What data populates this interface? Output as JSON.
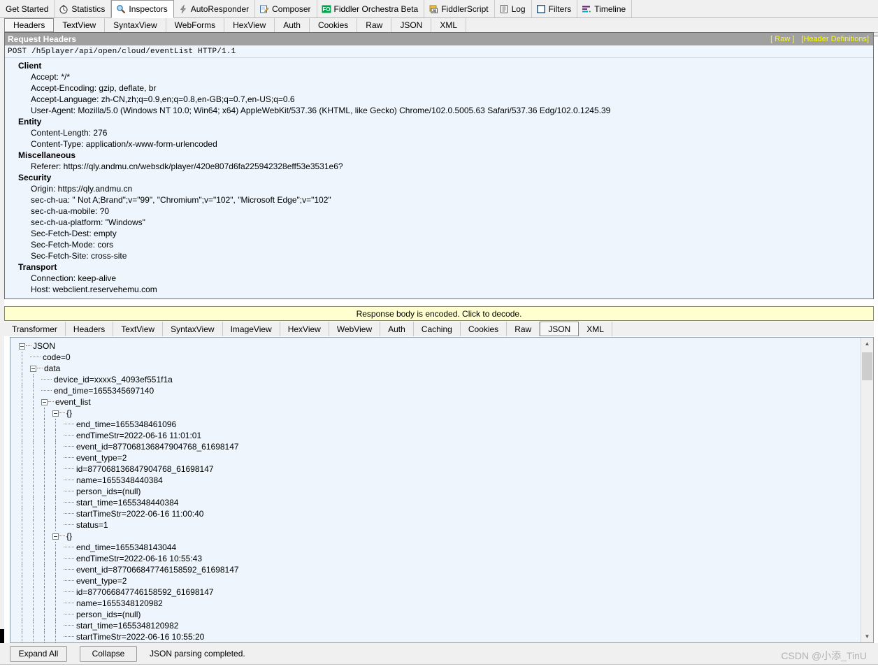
{
  "main_tabs": [
    {
      "label": "Get Started",
      "icon": "none",
      "selected": false
    },
    {
      "label": "Statistics",
      "icon": "stopwatch-icon",
      "selected": false
    },
    {
      "label": "Inspectors",
      "icon": "magnifier-icon",
      "selected": true
    },
    {
      "label": "AutoResponder",
      "icon": "lightning-icon",
      "selected": false
    },
    {
      "label": "Composer",
      "icon": "pencil-note-icon",
      "selected": false
    },
    {
      "label": "Fiddler Orchestra Beta",
      "icon": "fo-badge-icon",
      "selected": false
    },
    {
      "label": "FiddlerScript",
      "icon": "js-scroll-icon",
      "selected": false
    },
    {
      "label": "Log",
      "icon": "log-icon",
      "selected": false
    },
    {
      "label": "Filters",
      "icon": "filters-icon",
      "selected": false
    },
    {
      "label": "Timeline",
      "icon": "timeline-icon",
      "selected": false
    }
  ],
  "request_tabs": [
    {
      "label": "Headers",
      "selected": true
    },
    {
      "label": "TextView",
      "selected": false
    },
    {
      "label": "SyntaxView",
      "selected": false
    },
    {
      "label": "WebForms",
      "selected": false
    },
    {
      "label": "HexView",
      "selected": false
    },
    {
      "label": "Auth",
      "selected": false
    },
    {
      "label": "Cookies",
      "selected": false
    },
    {
      "label": "Raw",
      "selected": false
    },
    {
      "label": "JSON",
      "selected": false
    },
    {
      "label": "XML",
      "selected": false
    }
  ],
  "request_headers": {
    "title": "Request Headers",
    "raw_link": "[ Raw ]",
    "definitions_link": "[Header Definitions]",
    "request_line": "POST /h5player/api/open/cloud/eventList HTTP/1.1",
    "groups": [
      {
        "name": "Client",
        "items": [
          "Accept: */*",
          "Accept-Encoding: gzip, deflate, br",
          "Accept-Language: zh-CN,zh;q=0.9,en;q=0.8,en-GB;q=0.7,en-US;q=0.6",
          "User-Agent: Mozilla/5.0 (Windows NT 10.0; Win64; x64) AppleWebKit/537.36 (KHTML, like Gecko) Chrome/102.0.5005.63 Safari/537.36 Edg/102.0.1245.39"
        ]
      },
      {
        "name": "Entity",
        "items": [
          "Content-Length: 276",
          "Content-Type: application/x-www-form-urlencoded"
        ]
      },
      {
        "name": "Miscellaneous",
        "items": [
          "Referer: https://qly.andmu.cn/websdk/player/420e807d6fa225942328eff53e3531e6?"
        ]
      },
      {
        "name": "Security",
        "items": [
          "Origin: https://qly.andmu.cn",
          "sec-ch-ua: \" Not A;Brand\";v=\"99\", \"Chromium\";v=\"102\", \"Microsoft Edge\";v=\"102\"",
          "sec-ch-ua-mobile: ?0",
          "sec-ch-ua-platform: \"Windows\"",
          "Sec-Fetch-Dest: empty",
          "Sec-Fetch-Mode: cors",
          "Sec-Fetch-Site: cross-site"
        ]
      },
      {
        "name": "Transport",
        "items": [
          "Connection: keep-alive",
          "Host: webclient.reservehemu.com"
        ]
      }
    ]
  },
  "decode_notice": "Response body is encoded. Click to decode.",
  "response_tabs": [
    {
      "label": "Transformer",
      "selected": false
    },
    {
      "label": "Headers",
      "selected": false
    },
    {
      "label": "TextView",
      "selected": false
    },
    {
      "label": "SyntaxView",
      "selected": false
    },
    {
      "label": "ImageView",
      "selected": false
    },
    {
      "label": "HexView",
      "selected": false
    },
    {
      "label": "WebView",
      "selected": false
    },
    {
      "label": "Auth",
      "selected": false
    },
    {
      "label": "Caching",
      "selected": false
    },
    {
      "label": "Cookies",
      "selected": false
    },
    {
      "label": "Raw",
      "selected": false
    },
    {
      "label": "JSON",
      "selected": true
    },
    {
      "label": "XML",
      "selected": false
    }
  ],
  "json_tree": [
    {
      "depth": 0,
      "label": "JSON",
      "type": "branch"
    },
    {
      "depth": 1,
      "label": "code=0",
      "type": "leaf"
    },
    {
      "depth": 1,
      "label": "data",
      "type": "branch"
    },
    {
      "depth": 2,
      "label": "device_id=xxxxS_4093ef551f1a",
      "type": "leaf"
    },
    {
      "depth": 2,
      "label": "end_time=1655345697140",
      "type": "leaf"
    },
    {
      "depth": 2,
      "label": "event_list",
      "type": "branch"
    },
    {
      "depth": 3,
      "label": "{}",
      "type": "branch"
    },
    {
      "depth": 4,
      "label": "end_time=1655348461096",
      "type": "leaf"
    },
    {
      "depth": 4,
      "label": "endTimeStr=2022-06-16 11:01:01",
      "type": "leaf"
    },
    {
      "depth": 4,
      "label": "event_id=877068136847904768_61698147",
      "type": "leaf"
    },
    {
      "depth": 4,
      "label": "event_type=2",
      "type": "leaf"
    },
    {
      "depth": 4,
      "label": "id=877068136847904768_61698147",
      "type": "leaf"
    },
    {
      "depth": 4,
      "label": "name=1655348440384",
      "type": "leaf"
    },
    {
      "depth": 4,
      "label": "person_ids=(null)",
      "type": "leaf"
    },
    {
      "depth": 4,
      "label": "start_time=1655348440384",
      "type": "leaf"
    },
    {
      "depth": 4,
      "label": "startTimeStr=2022-06-16 11:00:40",
      "type": "leaf"
    },
    {
      "depth": 4,
      "label": "status=1",
      "type": "leaf"
    },
    {
      "depth": 3,
      "label": "{}",
      "type": "branch"
    },
    {
      "depth": 4,
      "label": "end_time=1655348143044",
      "type": "leaf"
    },
    {
      "depth": 4,
      "label": "endTimeStr=2022-06-16 10:55:43",
      "type": "leaf"
    },
    {
      "depth": 4,
      "label": "event_id=877066847746158592_61698147",
      "type": "leaf"
    },
    {
      "depth": 4,
      "label": "event_type=2",
      "type": "leaf"
    },
    {
      "depth": 4,
      "label": "id=877066847746158592_61698147",
      "type": "leaf"
    },
    {
      "depth": 4,
      "label": "name=1655348120982",
      "type": "leaf"
    },
    {
      "depth": 4,
      "label": "person_ids=(null)",
      "type": "leaf"
    },
    {
      "depth": 4,
      "label": "start_time=1655348120982",
      "type": "leaf"
    },
    {
      "depth": 4,
      "label": "startTimeStr=2022-06-16 10:55:20",
      "type": "leaf"
    }
  ],
  "footer": {
    "expand_all_label": "Expand All",
    "collapse_label": "Collapse",
    "status": "JSON parsing completed."
  },
  "watermark": "CSDN @小添_TinU",
  "scroll": {
    "up_arrow": "▲",
    "down_arrow": "▼"
  }
}
